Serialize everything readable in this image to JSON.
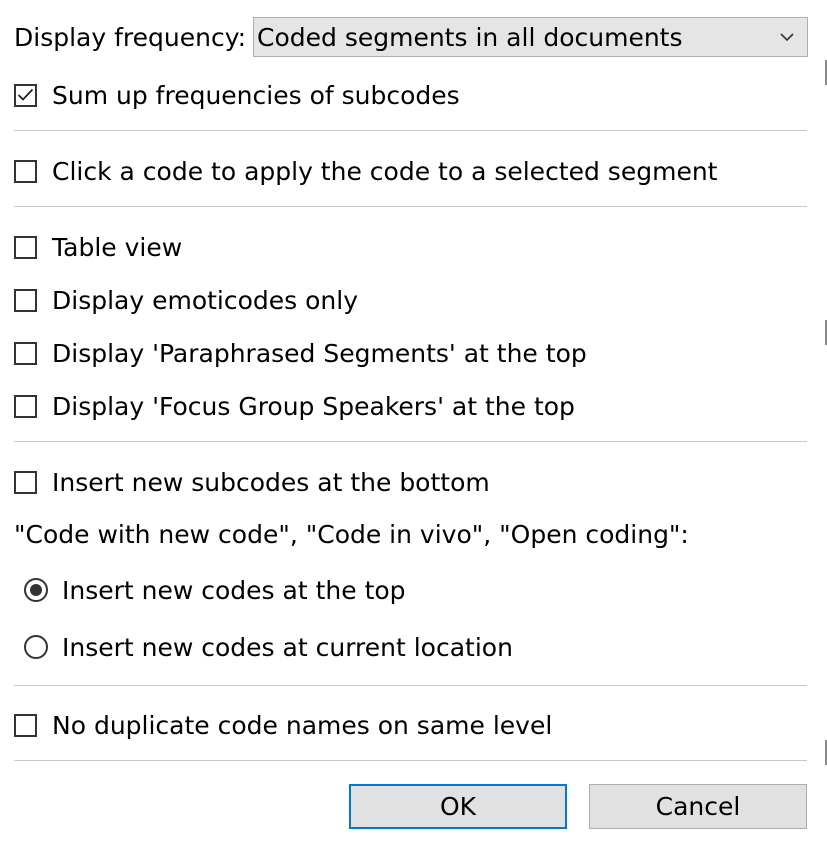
{
  "display_frequency": {
    "label": "Display frequency:",
    "selected": "Coded segments in all documents",
    "icon": "chevron-down-icon"
  },
  "checkboxes": {
    "sum_subcodes": {
      "label": "Sum up frequencies of subcodes",
      "checked": true
    },
    "click_apply": {
      "label": "Click a code to apply the code to a selected segment",
      "checked": false
    },
    "table_view": {
      "label": "Table view",
      "checked": false
    },
    "emoticodes": {
      "label": "Display emoticodes only",
      "checked": false
    },
    "paraphrased": {
      "label": "Display 'Paraphrased Segments' at the top",
      "checked": false
    },
    "focus_group": {
      "label": "Display 'Focus Group Speakers' at the top",
      "checked": false
    },
    "subcodes_bottom": {
      "label": "Insert new subcodes at the bottom",
      "checked": false
    },
    "no_duplicate": {
      "label": "No duplicate code names on same level",
      "checked": false
    }
  },
  "coding_section": {
    "label": "\"Code with new code\", \"Code in vivo\", \"Open coding\":",
    "radios": {
      "top": {
        "label": "Insert new codes at the top",
        "selected": true
      },
      "current": {
        "label": "Insert new codes at current location",
        "selected": false
      }
    }
  },
  "buttons": {
    "ok": "OK",
    "cancel": "Cancel"
  },
  "colors": {
    "accent_border": "#0078d7",
    "button_bg": "#e1e1e1",
    "select_bg": "#e5e5e5",
    "separator": "#c8c8c8"
  }
}
